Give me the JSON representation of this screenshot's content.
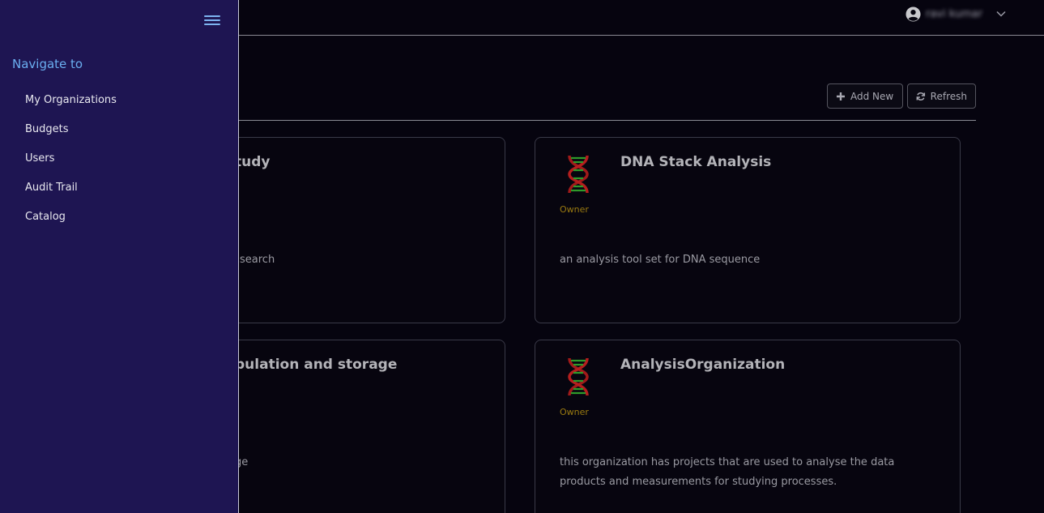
{
  "header": {
    "user_name": "ravi kumar"
  },
  "toolbar": {
    "add_label": "Add New",
    "refresh_label": "Refresh"
  },
  "cards": [
    {
      "title": "tudy",
      "description": "search"
    },
    {
      "title": "DNA Stack Analysis",
      "role": "Owner",
      "description": "an analysis tool set for DNA sequence"
    },
    {
      "title": "pulation and storage",
      "description": "ge"
    },
    {
      "title": "AnalysisOrganization",
      "role": "Owner",
      "description": "this organization has projects that are used to analyse the data products and measurements for studying processes."
    }
  ],
  "sidebar": {
    "heading": "Navigate to",
    "items": [
      {
        "label": "My Organizations"
      },
      {
        "label": "Budgets"
      },
      {
        "label": "Users"
      },
      {
        "label": "Audit Trail"
      },
      {
        "label": "Catalog"
      }
    ]
  },
  "colors": {
    "background": "#06040f",
    "sidebar": "#1e1552",
    "accent": "#6aaef0",
    "role": "#9a7a10"
  },
  "icons": [
    "user-avatar-icon",
    "chevron-down-icon",
    "plus-icon",
    "refresh-icon",
    "dna-icon",
    "hamburger-menu-icon"
  ]
}
